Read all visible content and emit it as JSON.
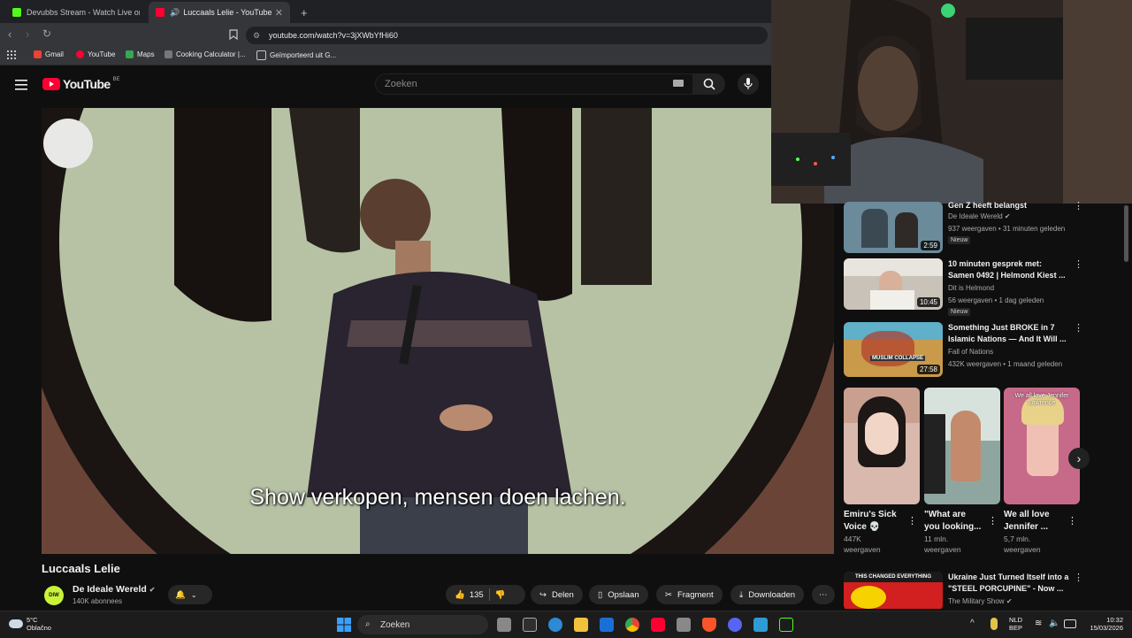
{
  "browser": {
    "tabs": [
      {
        "title": "Devubbs Stream - Watch Live on",
        "favicon_color": "#53fc18"
      },
      {
        "title": "Luccaals Lelie - YouTube",
        "favicon_color": "#ff0033"
      }
    ],
    "new_tab": "+",
    "url": "youtube.com/watch?v=3jXWbYfHi60",
    "bookmarks": [
      "Gmail",
      "YouTube",
      "Maps",
      "Cooking Calculator |...",
      "Geïmporteerd uit G..."
    ]
  },
  "youtube": {
    "logo_text": "YouTube",
    "country": "BE",
    "search_placeholder": "Zoeken"
  },
  "video": {
    "subtitle": "Show verkopen, mensen doen lachen.",
    "title": "Luccaals Lelie",
    "channel": "De Ideale Wereld",
    "channel_avatar_text": "DIW",
    "subscribers": "140K abonnees",
    "likes": "135",
    "actions": {
      "share": "Delen",
      "save": "Opslaan",
      "clip": "Fragment",
      "download": "Downloaden"
    }
  },
  "recommendations": [
    {
      "title_lines": [
        "Gen Z heeft belangst"
      ],
      "channel": "De Ideale Wereld",
      "meta": "937 weergaven • 31 minuten geleden",
      "badge": "Nieuw",
      "duration": "2:59",
      "thumb_color": "#6b8a9a"
    },
    {
      "title_lines": [
        "10 minuten gesprek met:",
        "Samen 0492 | Helmond Kiest ..."
      ],
      "channel": "Dit is Helmond",
      "meta": "56 weergaven • 1 dag geleden",
      "badge": "Nieuw",
      "duration": "10:45",
      "thumb_color": "#c9c2b8"
    },
    {
      "title_lines": [
        "Something Just BROKE in 7",
        "Islamic Nations — And It Will ..."
      ],
      "channel": "Fall of Nations",
      "meta": "432K weergaven • 1 maand geleden",
      "badge": "",
      "duration": "27:58",
      "thumb_color": "#c89a4a"
    },
    {
      "title_lines": [
        "Ukraine Just Turned Itself into a",
        "\"STEEL PORCUPINE\" - Now ..."
      ],
      "channel": "The Military Show",
      "meta": "",
      "badge": "",
      "duration": "",
      "thumb_color": "#d21f1f",
      "thumb_text": "THIS CHANGED EVERYTHING"
    }
  ],
  "shorts": [
    {
      "title_lines": [
        "Emiru's Sick",
        "Voice 💀"
      ],
      "views": "447K",
      "views_label": "weergaven",
      "thumb_color": "#d9b8ae"
    },
    {
      "title_lines": [
        "\"What are",
        "you looking..."
      ],
      "views": "11 mln.",
      "views_label": "weergaven",
      "thumb_color": "#8fa6a0"
    },
    {
      "title_lines": [
        "We all love",
        "Jennifer ..."
      ],
      "views": "5,7 mln.",
      "views_label": "weergaven",
      "thumb_color": "#c76a8a",
      "thumb_text": "We all love Jennifer Lawrence"
    }
  ],
  "taskbar": {
    "weather_temp": "5°C",
    "weather_desc": "Oblačno",
    "search": "Zoeken",
    "lang_top": "NLD",
    "lang_bottom": "BEP",
    "time": "10:32",
    "date": "15/03/2026"
  },
  "colors": {
    "youtube_red": "#ff0033",
    "accent": "#3ea6ff"
  }
}
